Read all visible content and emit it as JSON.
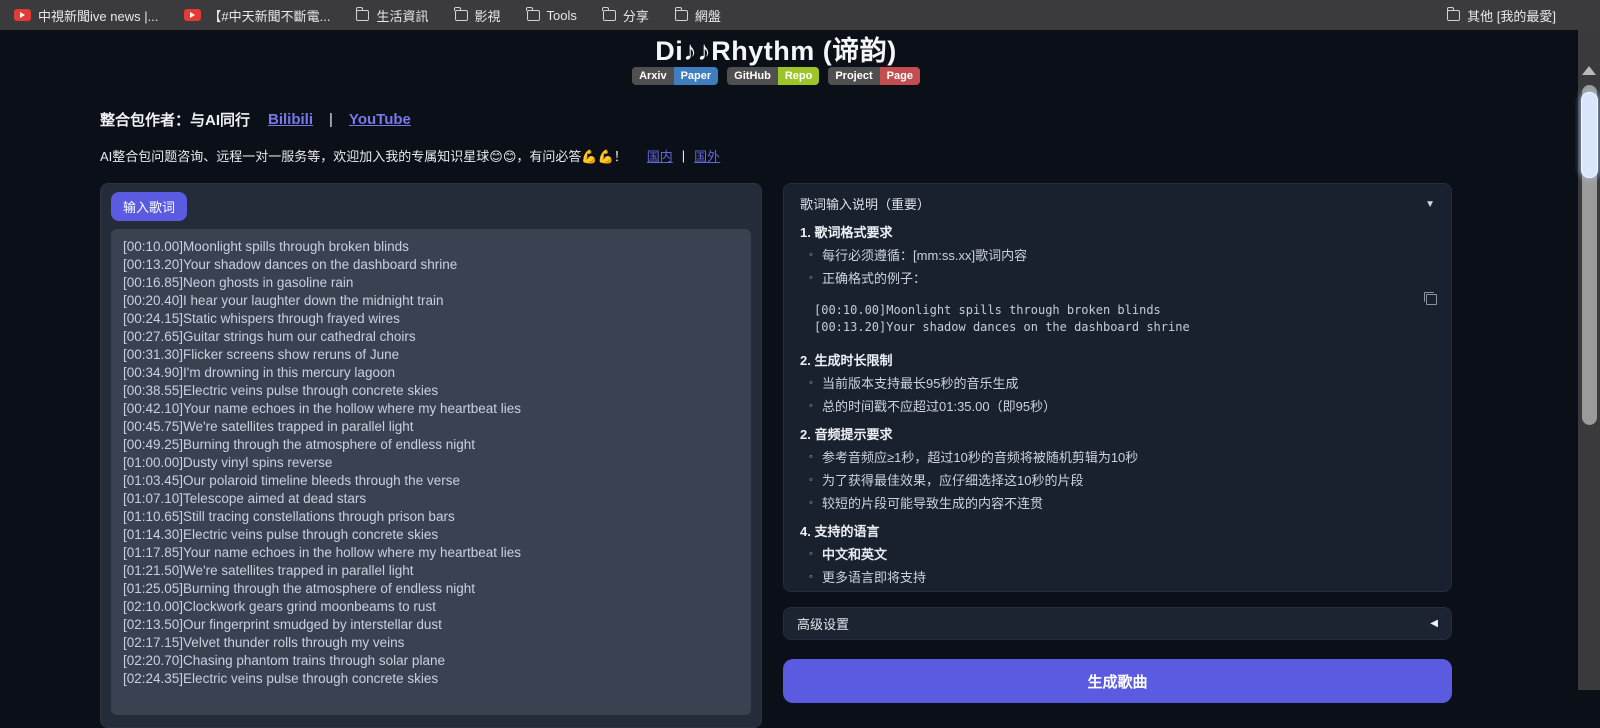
{
  "bookmarks_bar": {
    "items": [
      {
        "icon": "youtube",
        "label": "中視新聞ive news |..."
      },
      {
        "icon": "youtube",
        "label": "【#中天新聞不斷電..."
      },
      {
        "icon": "folder",
        "label": "生活資訊"
      },
      {
        "icon": "folder",
        "label": "影視"
      },
      {
        "icon": "folder",
        "label": "Tools"
      },
      {
        "icon": "folder",
        "label": "分享"
      },
      {
        "icon": "folder",
        "label": "網盤"
      }
    ],
    "overflow_item": {
      "icon": "folder",
      "label": "其他 [我的最愛]"
    }
  },
  "header": {
    "title": "Di♪♪Rhythm (谛韵)",
    "badges": [
      {
        "left": "Arxiv",
        "right": "Paper"
      },
      {
        "left": "GitHub",
        "right": "Repo"
      },
      {
        "left": "Project",
        "right": "Page"
      }
    ],
    "author_label": "整合包作者：与AI同行",
    "link_bilibili": "Bilibili",
    "link_youtube": "YouTube",
    "link_separator": "|",
    "promo_text": "AI整合包问题咨询、远程一对一服务等，欢迎加入我的专属知识星球😊😊，有问必答💪💪！",
    "promo_link_domestic": "国内",
    "promo_link_overseas": "国外"
  },
  "lyrics_panel": {
    "label": "输入歌词",
    "lines": [
      "[00:10.00]Moonlight spills through broken blinds",
      "[00:13.20]Your shadow dances on the dashboard shrine",
      "[00:16.85]Neon ghosts in gasoline rain",
      "[00:20.40]I hear your laughter down the midnight train",
      "[00:24.15]Static whispers through frayed wires",
      "[00:27.65]Guitar strings hum our cathedral choirs",
      "[00:31.30]Flicker screens show reruns of June",
      "[00:34.90]I'm drowning in this mercury lagoon",
      "[00:38.55]Electric veins pulse through concrete skies",
      "[00:42.10]Your name echoes in the hollow where my heartbeat lies",
      "[00:45.75]We're satellites trapped in parallel light",
      "[00:49.25]Burning through the atmosphere of endless night",
      "[01:00.00]Dusty vinyl spins reverse",
      "[01:03.45]Our polaroid timeline bleeds through the verse",
      "[01:07.10]Telescope aimed at dead stars",
      "[01:10.65]Still tracing constellations through prison bars",
      "[01:14.30]Electric veins pulse through concrete skies",
      "[01:17.85]Your name echoes in the hollow where my heartbeat lies",
      "[01:21.50]We're satellites trapped in parallel light",
      "[01:25.05]Burning through the atmosphere of endless night",
      "[02:10.00]Clockwork gears grind moonbeams to rust",
      "[02:13.50]Our fingerprint smudged by interstellar dust",
      "[02:17.15]Velvet thunder rolls through my veins",
      "[02:20.70]Chasing phantom trains through solar plane",
      "[02:24.35]Electric veins pulse through concrete skies"
    ]
  },
  "instructions_panel": {
    "title": "歌词输入说明（重要）",
    "collapse_icon": "▼",
    "blocks": [
      {
        "type": "heading",
        "text": "1. 歌词格式要求"
      },
      {
        "type": "bullet",
        "text": "每行必须遵循：[mm:ss.xx]歌词内容"
      },
      {
        "type": "bullet",
        "text": "正确格式的例子："
      },
      {
        "type": "code",
        "lines": [
          "[00:10.00]Moonlight spills through broken blinds",
          "[00:13.20]Your shadow dances on the dashboard shrine"
        ]
      },
      {
        "type": "heading",
        "text": "2. 生成时长限制"
      },
      {
        "type": "bullet",
        "text": "当前版本支持最长95秒的音乐生成"
      },
      {
        "type": "bullet",
        "text": "总的时间戳不应超过01:35.00（即95秒）"
      },
      {
        "type": "heading",
        "text": "2. 音频提示要求"
      },
      {
        "type": "bullet",
        "text": "参考音频应≥1秒，超过10秒的音频将被随机剪辑为10秒"
      },
      {
        "type": "bullet",
        "text": "为了获得最佳效果，应仔细选择这10秒的片段"
      },
      {
        "type": "bullet",
        "text": "较短的片段可能导致生成的内容不连贯"
      },
      {
        "type": "heading",
        "text": "4. 支持的语言"
      },
      {
        "type": "bullet",
        "text": "中文和英文",
        "bold": true
      },
      {
        "type": "bullet",
        "text": "更多语言即将支持"
      }
    ]
  },
  "advanced_panel": {
    "label": "高级设置",
    "collapse_icon": "◀"
  },
  "generate_button": {
    "label": "生成歌曲"
  },
  "colors": {
    "accent_purple": "#5a5be0",
    "badge_gray": "#4f4f4f",
    "badge_blue": "#3e7ebf",
    "badge_green": "#9ec528",
    "badge_red": "#c24e50",
    "page_background": "#0b0f18"
  }
}
